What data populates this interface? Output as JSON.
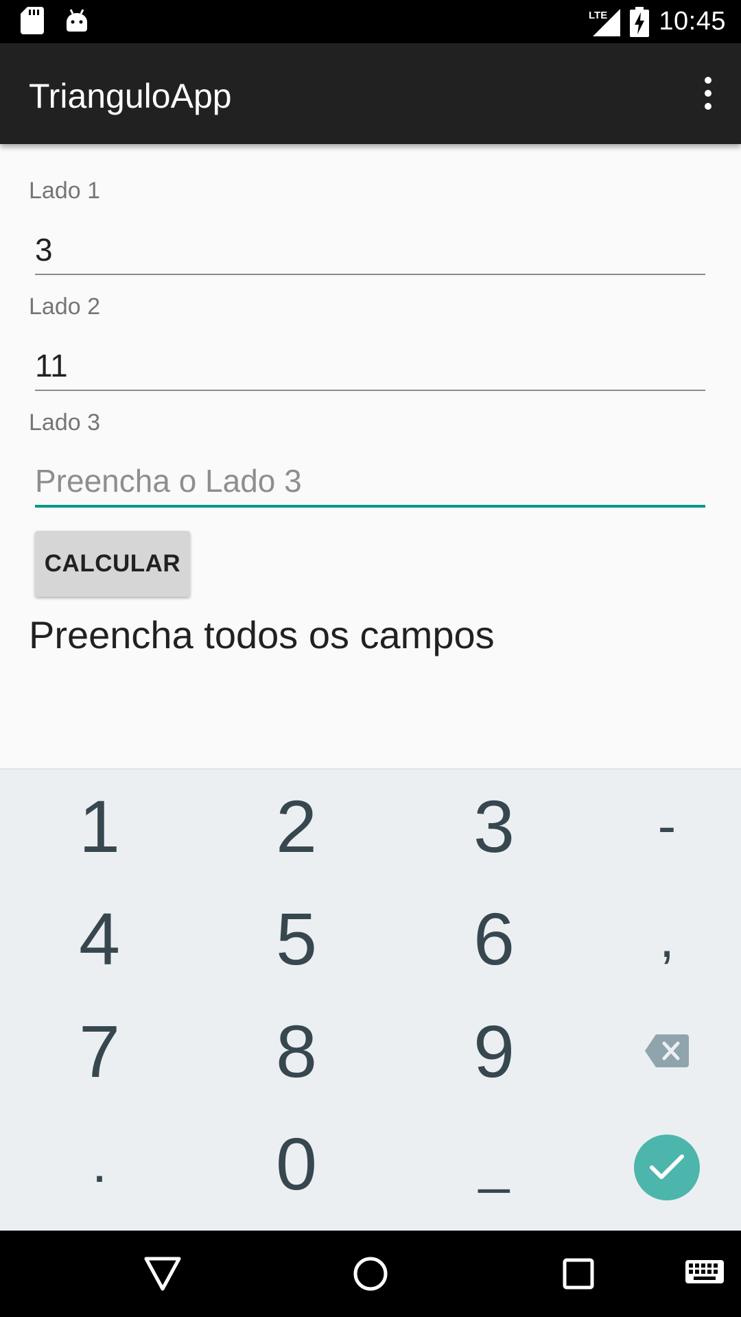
{
  "status_bar": {
    "time": "10:45",
    "network": "LTE",
    "icons": [
      "sd-card-icon",
      "android-icon",
      "lte-signal-icon",
      "battery-charging-icon"
    ]
  },
  "app_bar": {
    "title": "TrianguloApp",
    "menu_icon": "overflow-menu-icon"
  },
  "form": {
    "side1": {
      "label": "Lado 1",
      "value": "3"
    },
    "side2": {
      "label": "Lado 2",
      "value": "11"
    },
    "side3": {
      "label": "Lado 3",
      "value": "",
      "placeholder": "Preencha o Lado 3"
    },
    "calculate_label": "CALCULAR",
    "result": "Preencha todos os campos"
  },
  "keyboard": {
    "row1": [
      "1",
      "2",
      "3",
      "-"
    ],
    "row2": [
      "4",
      "5",
      "6",
      ","
    ],
    "row3": [
      "7",
      "8",
      "9"
    ],
    "row4": [
      ".",
      "0",
      "_"
    ],
    "backspace_icon": "backspace-icon",
    "enter_icon": "checkmark-icon",
    "accent": "#4db6ac"
  },
  "nav_bar": {
    "icons": [
      "back-icon",
      "home-icon",
      "recents-icon",
      "keyboard-switch-icon"
    ]
  },
  "colors": {
    "app_bar": "#212121",
    "focus_accent": "#009688",
    "background": "#fafafa",
    "keyboard_bg": "#eceff1"
  }
}
